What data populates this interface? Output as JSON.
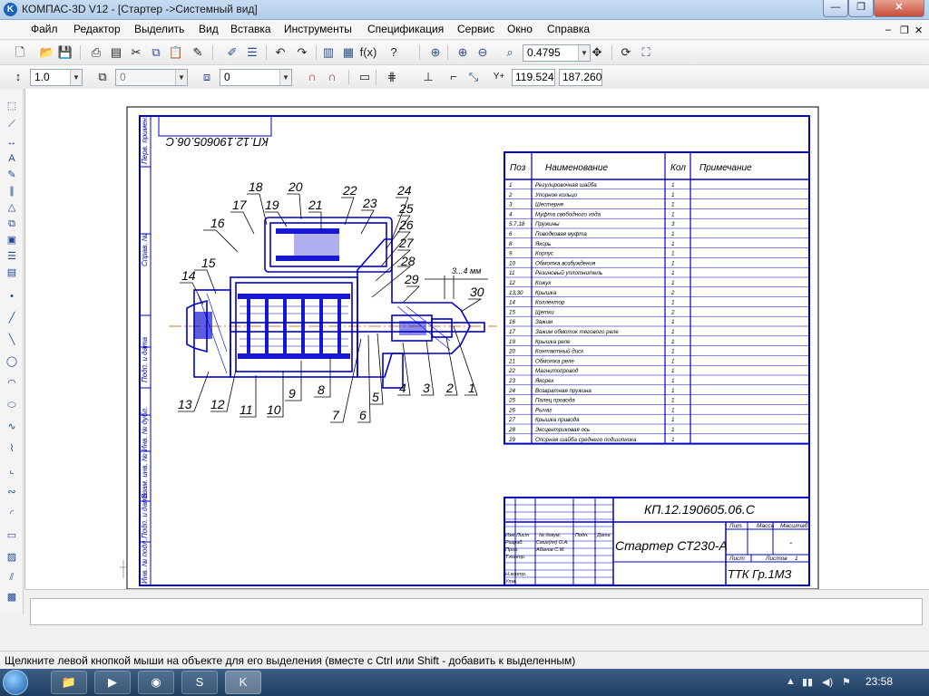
{
  "window": {
    "title": "КОМПАС-3D V12 - [Стартер ->Системный вид]",
    "app_icon": "kompas-logo-icon"
  },
  "menu": [
    "Файл",
    "Редактор",
    "Выделить",
    "Вид",
    "Вставка",
    "Инструменты",
    "Спецификация",
    "Сервис",
    "Окно",
    "Справка"
  ],
  "toolbar1": {
    "zoom_value": "0.4795"
  },
  "toolbar2": {
    "line_weight": "1.0",
    "style_value": "0",
    "layer_value": "0",
    "coord_x": "119.524",
    "coord_y": "187.260"
  },
  "drawing": {
    "mirrored_code": "КП.12.190605.06.С",
    "sidebar_labels": [
      "Перв. примен.",
      "Справ. №",
      "Подп. и дата",
      "Инв. № дубл.",
      "Взам. инв. №",
      "Подп. и дата",
      "Инв. № подл."
    ],
    "callouts": [
      "18",
      "20",
      "22",
      "23",
      "24",
      "17",
      "19",
      "21",
      "25",
      "16",
      "26",
      "27",
      "15",
      "28",
      "14",
      "29",
      "30",
      "13",
      "12",
      "11",
      "10",
      "9",
      "8",
      "7",
      "6",
      "5",
      "4",
      "3",
      "2",
      "1"
    ],
    "dimension": "3...4 мм",
    "spec_headers": {
      "pos": "Поз",
      "name": "Наименование",
      "qty": "Кол",
      "note": "Примечание"
    },
    "spec_rows": [
      {
        "pos": "1",
        "name": "Регулировочная шайба",
        "qty": "1"
      },
      {
        "pos": "2",
        "name": "Упорное кольцо",
        "qty": "1"
      },
      {
        "pos": "3",
        "name": "Шестерня",
        "qty": "1"
      },
      {
        "pos": "4",
        "name": "Муфта свободного хода",
        "qty": "1"
      },
      {
        "pos": "5,7,18",
        "name": "Пружины",
        "qty": "3"
      },
      {
        "pos": "6",
        "name": "Поводковая муфта",
        "qty": "1"
      },
      {
        "pos": "8",
        "name": "Якорь",
        "qty": "1"
      },
      {
        "pos": "9",
        "name": "Корпус",
        "qty": "1"
      },
      {
        "pos": "10",
        "name": "Обмотка возбуждения",
        "qty": "1"
      },
      {
        "pos": "11",
        "name": "Резиновый уплотнитель",
        "qty": "1"
      },
      {
        "pos": "12",
        "name": "Кожух",
        "qty": "1"
      },
      {
        "pos": "13,30",
        "name": "Крышка",
        "qty": "2"
      },
      {
        "pos": "14",
        "name": "Коллектор",
        "qty": "1"
      },
      {
        "pos": "15",
        "name": "Щетки",
        "qty": "2"
      },
      {
        "pos": "16",
        "name": "Зажим",
        "qty": "1"
      },
      {
        "pos": "17",
        "name": "Зажим обмоток тягового реле",
        "qty": "1"
      },
      {
        "pos": "19",
        "name": "Крышка реле",
        "qty": "1"
      },
      {
        "pos": "20",
        "name": "Контактный диск",
        "qty": "1"
      },
      {
        "pos": "21",
        "name": "Обмотка реле",
        "qty": "1"
      },
      {
        "pos": "22",
        "name": "Магнитопровод",
        "qty": "1"
      },
      {
        "pos": "23",
        "name": "Якорек",
        "qty": "1"
      },
      {
        "pos": "24",
        "name": "Возвратная пружина",
        "qty": "1"
      },
      {
        "pos": "25",
        "name": "Палец провода",
        "qty": "1"
      },
      {
        "pos": "26",
        "name": "Рычаг",
        "qty": "1"
      },
      {
        "pos": "27",
        "name": "Крышка привода",
        "qty": "1"
      },
      {
        "pos": "28",
        "name": "Эксцентриковая ось",
        "qty": "1"
      },
      {
        "pos": "29",
        "name": "Опорная шайба среднего подшипника",
        "qty": "1"
      }
    ],
    "stamp": {
      "code": "КП.12.190605.06.С",
      "name": "Стартер СТ230-А",
      "org": "ТТК Гр.1МЗ",
      "lit": "Лит.",
      "mass": "Масса",
      "scale": "Масштаб",
      "scale_value": "-",
      "sheet": "Лист",
      "sheets": "Листов",
      "sheets_value": "1",
      "col_headers": [
        "Изм.",
        "Лист",
        "№ докум.",
        "Подп.",
        "Дата"
      ],
      "roles": [
        "Разраб.",
        "Пров.",
        "Т.контр.",
        "Н.контр.",
        "Утв."
      ],
      "people": [
        "Смиг(пп) О.А.",
        "Абанов С.М."
      ]
    }
  },
  "status_text": "Щелкните левой кнопкой мыши на объекте для его выделения (вместе с Ctrl или Shift - добавить к выделенным)",
  "taskbar": {
    "clock": "23:58"
  }
}
